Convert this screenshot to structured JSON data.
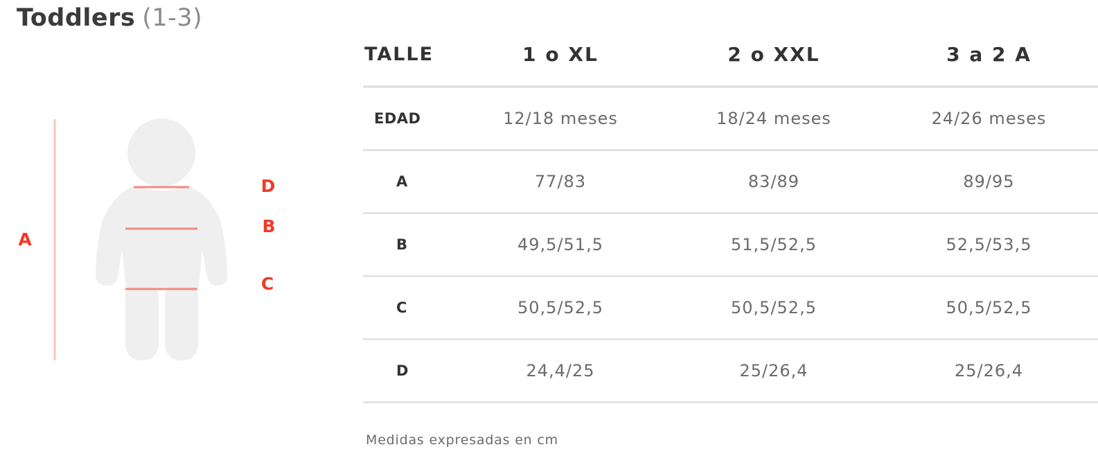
{
  "title": {
    "main": "Toddlers",
    "range": "(1-3)"
  },
  "figure": {
    "labels": {
      "a": "A",
      "b": "B",
      "c": "C",
      "d": "D"
    },
    "colors": {
      "silhouette": "#efefef",
      "measure_line": "#f08a80",
      "vertical_line": "#fbc4bd",
      "label": "#f03a27"
    }
  },
  "table": {
    "header": {
      "label": "TALLE",
      "sizes": [
        "1 o XL",
        "2 o XXL",
        "3 a 2 A"
      ]
    },
    "rows": [
      {
        "label": "EDAD",
        "values": [
          "12/18 meses",
          "18/24 meses",
          "24/26 meses"
        ]
      },
      {
        "label": "A",
        "values": [
          "77/83",
          "83/89",
          "89/95"
        ]
      },
      {
        "label": "B",
        "values": [
          "49,5/51,5",
          "51,5/52,5",
          "52,5/53,5"
        ]
      },
      {
        "label": "C",
        "values": [
          "50,5/52,5",
          "50,5/52,5",
          "50,5/52,5"
        ]
      },
      {
        "label": "D",
        "values": [
          "24,4/25",
          "25/26,4",
          "25/26,4"
        ]
      }
    ]
  },
  "note": "Medidas expresadas en cm"
}
